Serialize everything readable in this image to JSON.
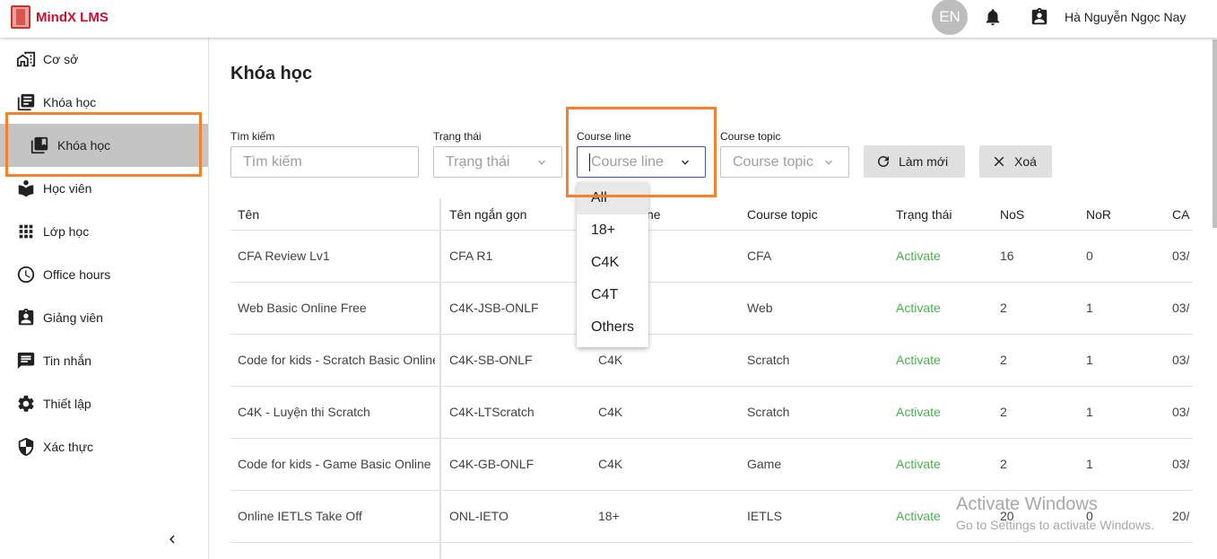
{
  "app": {
    "logo_text": "MindX LMS"
  },
  "header": {
    "lang": "EN",
    "user_name": "Hà Nguyễn Ngọc Nay"
  },
  "sidebar": {
    "items": [
      {
        "label": "Cơ sở",
        "icon": "building-icon"
      },
      {
        "label": "Khóa học",
        "icon": "book-list-icon"
      },
      {
        "label": "Khóa học",
        "icon": "library-books-icon",
        "sub": true,
        "selected": true
      },
      {
        "label": "Học viên",
        "icon": "open-book-icon"
      },
      {
        "label": "Lớp học",
        "icon": "grid-icon"
      },
      {
        "label": "Office hours",
        "icon": "clock-icon"
      },
      {
        "label": "Giảng viên",
        "icon": "badge-icon"
      },
      {
        "label": "Tin nhắn",
        "icon": "message-icon"
      },
      {
        "label": "Thiết lập",
        "icon": "gear-icon"
      },
      {
        "label": "Xác thực",
        "icon": "shield-icon"
      }
    ]
  },
  "main": {
    "title": "Khóa học",
    "filters": {
      "search_label": "Tìm kiếm",
      "search_placeholder": "Tìm kiếm",
      "status_label": "Trạng thái",
      "status_placeholder": "Trạng thái",
      "course_line_label": "Course line",
      "course_line_placeholder": "Course line",
      "course_topic_label": "Course topic",
      "course_topic_placeholder": "Course topic",
      "refresh_label": "Làm mới",
      "clear_label": "Xoá"
    },
    "course_line_options": [
      "All",
      "18+",
      "C4K",
      "C4T",
      "Others"
    ],
    "table": {
      "headers": [
        "Tên",
        "Tên ngắn gọn",
        "ne",
        "Course topic",
        "Trạng thái",
        "NoS",
        "NoR",
        "CA"
      ],
      "rows": [
        [
          "CFA Review Lv1",
          "CFA R1",
          "",
          "CFA",
          "Activate",
          "16",
          "0",
          "03/"
        ],
        [
          "Web Basic Online Free",
          "C4K-JSB-ONLF",
          "",
          "Web",
          "Activate",
          "2",
          "1",
          "03/"
        ],
        [
          "Code for kids - Scratch Basic Online",
          "C4K-SB-ONLF",
          "C4K",
          "Scratch",
          "Activate",
          "2",
          "1",
          "03/"
        ],
        [
          "C4K - Luyện thi Scratch",
          "C4K-LTScratch",
          "C4K",
          "Scratch",
          "Activate",
          "2",
          "1",
          "03/"
        ],
        [
          "Code for kids - Game Basic Online",
          "C4K-GB-ONLF",
          "C4K",
          "Game",
          "Activate",
          "2",
          "1",
          "03/"
        ],
        [
          "Online IETLS Take Off",
          "ONL-IETO",
          "18+",
          "IETLS",
          "Activate",
          "20",
          "0",
          "20/"
        ]
      ]
    }
  },
  "watermark": {
    "line1": "Activate Windows",
    "line2": "Go to Settings to activate Windows."
  },
  "colors": {
    "accent": "#3f51b5",
    "highlight": "#f5822a",
    "status": "#4caf50",
    "brand": "#c8102e"
  }
}
